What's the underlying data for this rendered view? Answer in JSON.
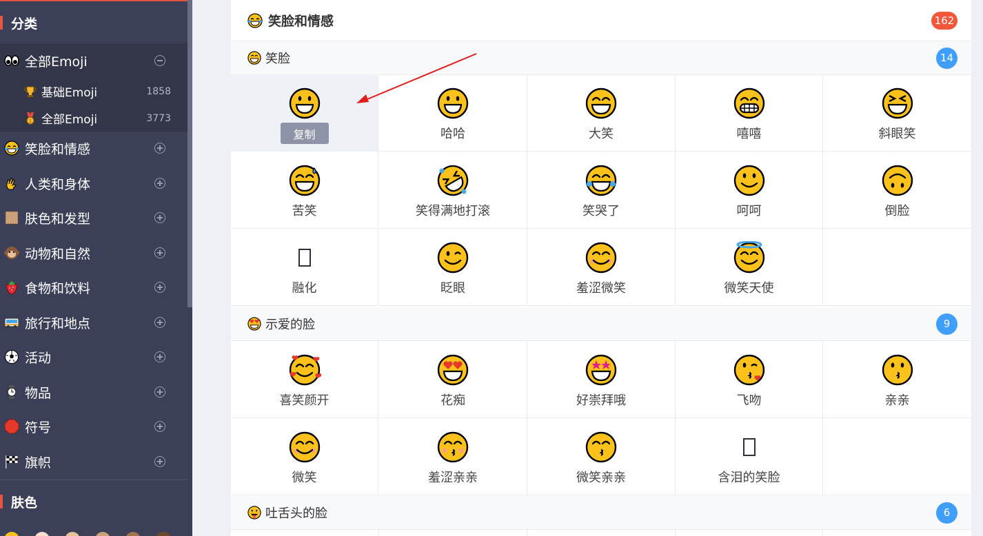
{
  "sidebar": {
    "heading_categories": "分类",
    "heading_skin": "肤色",
    "all_emoji": {
      "label": "全部Emoji",
      "icon": "eyes-icon"
    },
    "children": [
      {
        "label": "基础Emoji",
        "count": "1858",
        "icon": "trophy-icon"
      },
      {
        "label": "全部Emoji",
        "count": "3773",
        "icon": "medal-icon"
      }
    ],
    "items": [
      {
        "label": "笑脸和情感",
        "icon": "laughing-face-icon"
      },
      {
        "label": "人类和身体",
        "icon": "ok-hand-icon"
      },
      {
        "label": "肤色和发型",
        "icon": "skin-swatch-icon"
      },
      {
        "label": "动物和自然",
        "icon": "monkey-icon"
      },
      {
        "label": "食物和饮料",
        "icon": "strawberry-icon"
      },
      {
        "label": "旅行和地点",
        "icon": "bus-icon"
      },
      {
        "label": "活动",
        "icon": "soccer-ball-icon"
      },
      {
        "label": "物品",
        "icon": "watch-icon"
      },
      {
        "label": "符号",
        "icon": "stop-sign-icon"
      },
      {
        "label": "旗帜",
        "icon": "checkered-flag-icon"
      }
    ],
    "colors": {
      "bg": "#3b3f57",
      "accent": "#e8563f"
    }
  },
  "category": {
    "title": "笑脸和情感",
    "count": "162",
    "icon": "laughing-face-icon"
  },
  "subgroups": [
    {
      "title": "笑脸",
      "count": "14",
      "icon": "smiling-face-icon",
      "items": [
        "",
        "哈哈",
        "大笑",
        "嘻嘻",
        "斜眼笑",
        "苦笑",
        "笑得满地打滚",
        "笑哭了",
        "呵呵",
        "倒脸",
        "融化",
        "眨眼",
        "羞涩微笑",
        "微笑天使"
      ]
    },
    {
      "title": "示爱的脸",
      "count": "9",
      "icon": "heart-eyes-icon",
      "items": [
        "喜笑颜开",
        "花痴",
        "好崇拜哦",
        "飞吻",
        "亲亲",
        "微笑",
        "羞涩亲亲",
        "微笑亲亲",
        "含泪的笑脸"
      ]
    },
    {
      "title": "吐舌头的脸",
      "count": "6",
      "icon": "tongue-face-icon",
      "items": []
    }
  ],
  "copy_button": "复制"
}
